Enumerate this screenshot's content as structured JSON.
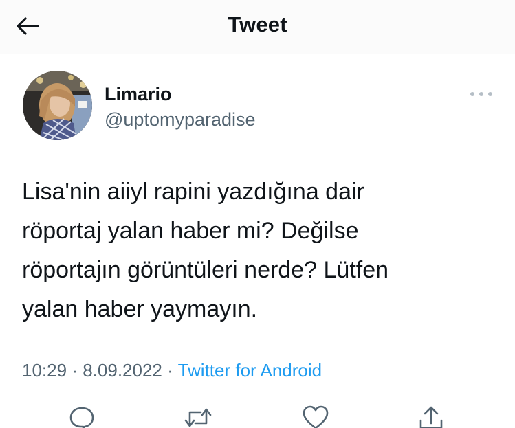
{
  "header": {
    "title": "Tweet",
    "back_icon": "arrow-left-icon"
  },
  "author": {
    "display_name": "Limario",
    "handle": "@uptomyparadise",
    "avatar": "profile-photo"
  },
  "tweet": {
    "text": "Lisa'nin aiiyl rapini yazdığına dair\nröportaj yalan haber mi? Değilse\nröportajın görüntüleri nerde? Lütfen\nyalan haber yaymayın.",
    "time": "10:29",
    "date": "8.09.2022",
    "separator": "·",
    "source": "Twitter for Android"
  },
  "actions": [
    {
      "name": "reply",
      "icon": "reply-icon"
    },
    {
      "name": "retweet",
      "icon": "retweet-icon"
    },
    {
      "name": "like",
      "icon": "heart-icon"
    },
    {
      "name": "share",
      "icon": "share-icon"
    }
  ],
  "colors": {
    "link": "#1d9bf0",
    "secondary_text": "#536471",
    "primary_text": "#0f1419"
  }
}
